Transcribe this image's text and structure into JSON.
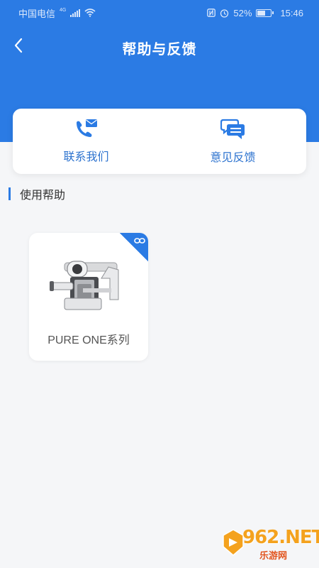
{
  "status_bar": {
    "carrier": "中国电信",
    "network_badge": "4G",
    "battery_percent": "52%",
    "time": "15:46",
    "icons": [
      "signal-icon",
      "wifi-icon",
      "nfc-icon",
      "alarm-icon",
      "battery-icon"
    ]
  },
  "header": {
    "title": "帮助与反馈",
    "back_icon": "chevron-left-icon"
  },
  "actions": [
    {
      "label": "联系我们",
      "icon": "phone-mail-icon"
    },
    {
      "label": "意见反馈",
      "icon": "chat-bubbles-icon"
    }
  ],
  "help_section": {
    "title": "使用帮助",
    "products": [
      {
        "name": "PURE ONE系列",
        "image": "vacuum-cleaner-image",
        "tag_icon": "link-icon"
      }
    ]
  },
  "watermark": {
    "text": "962.NET",
    "subtext": "乐游网"
  },
  "colors": {
    "primary": "#2b7be4",
    "accent_text": "#2d73cf",
    "background": "#f5f6f8"
  }
}
